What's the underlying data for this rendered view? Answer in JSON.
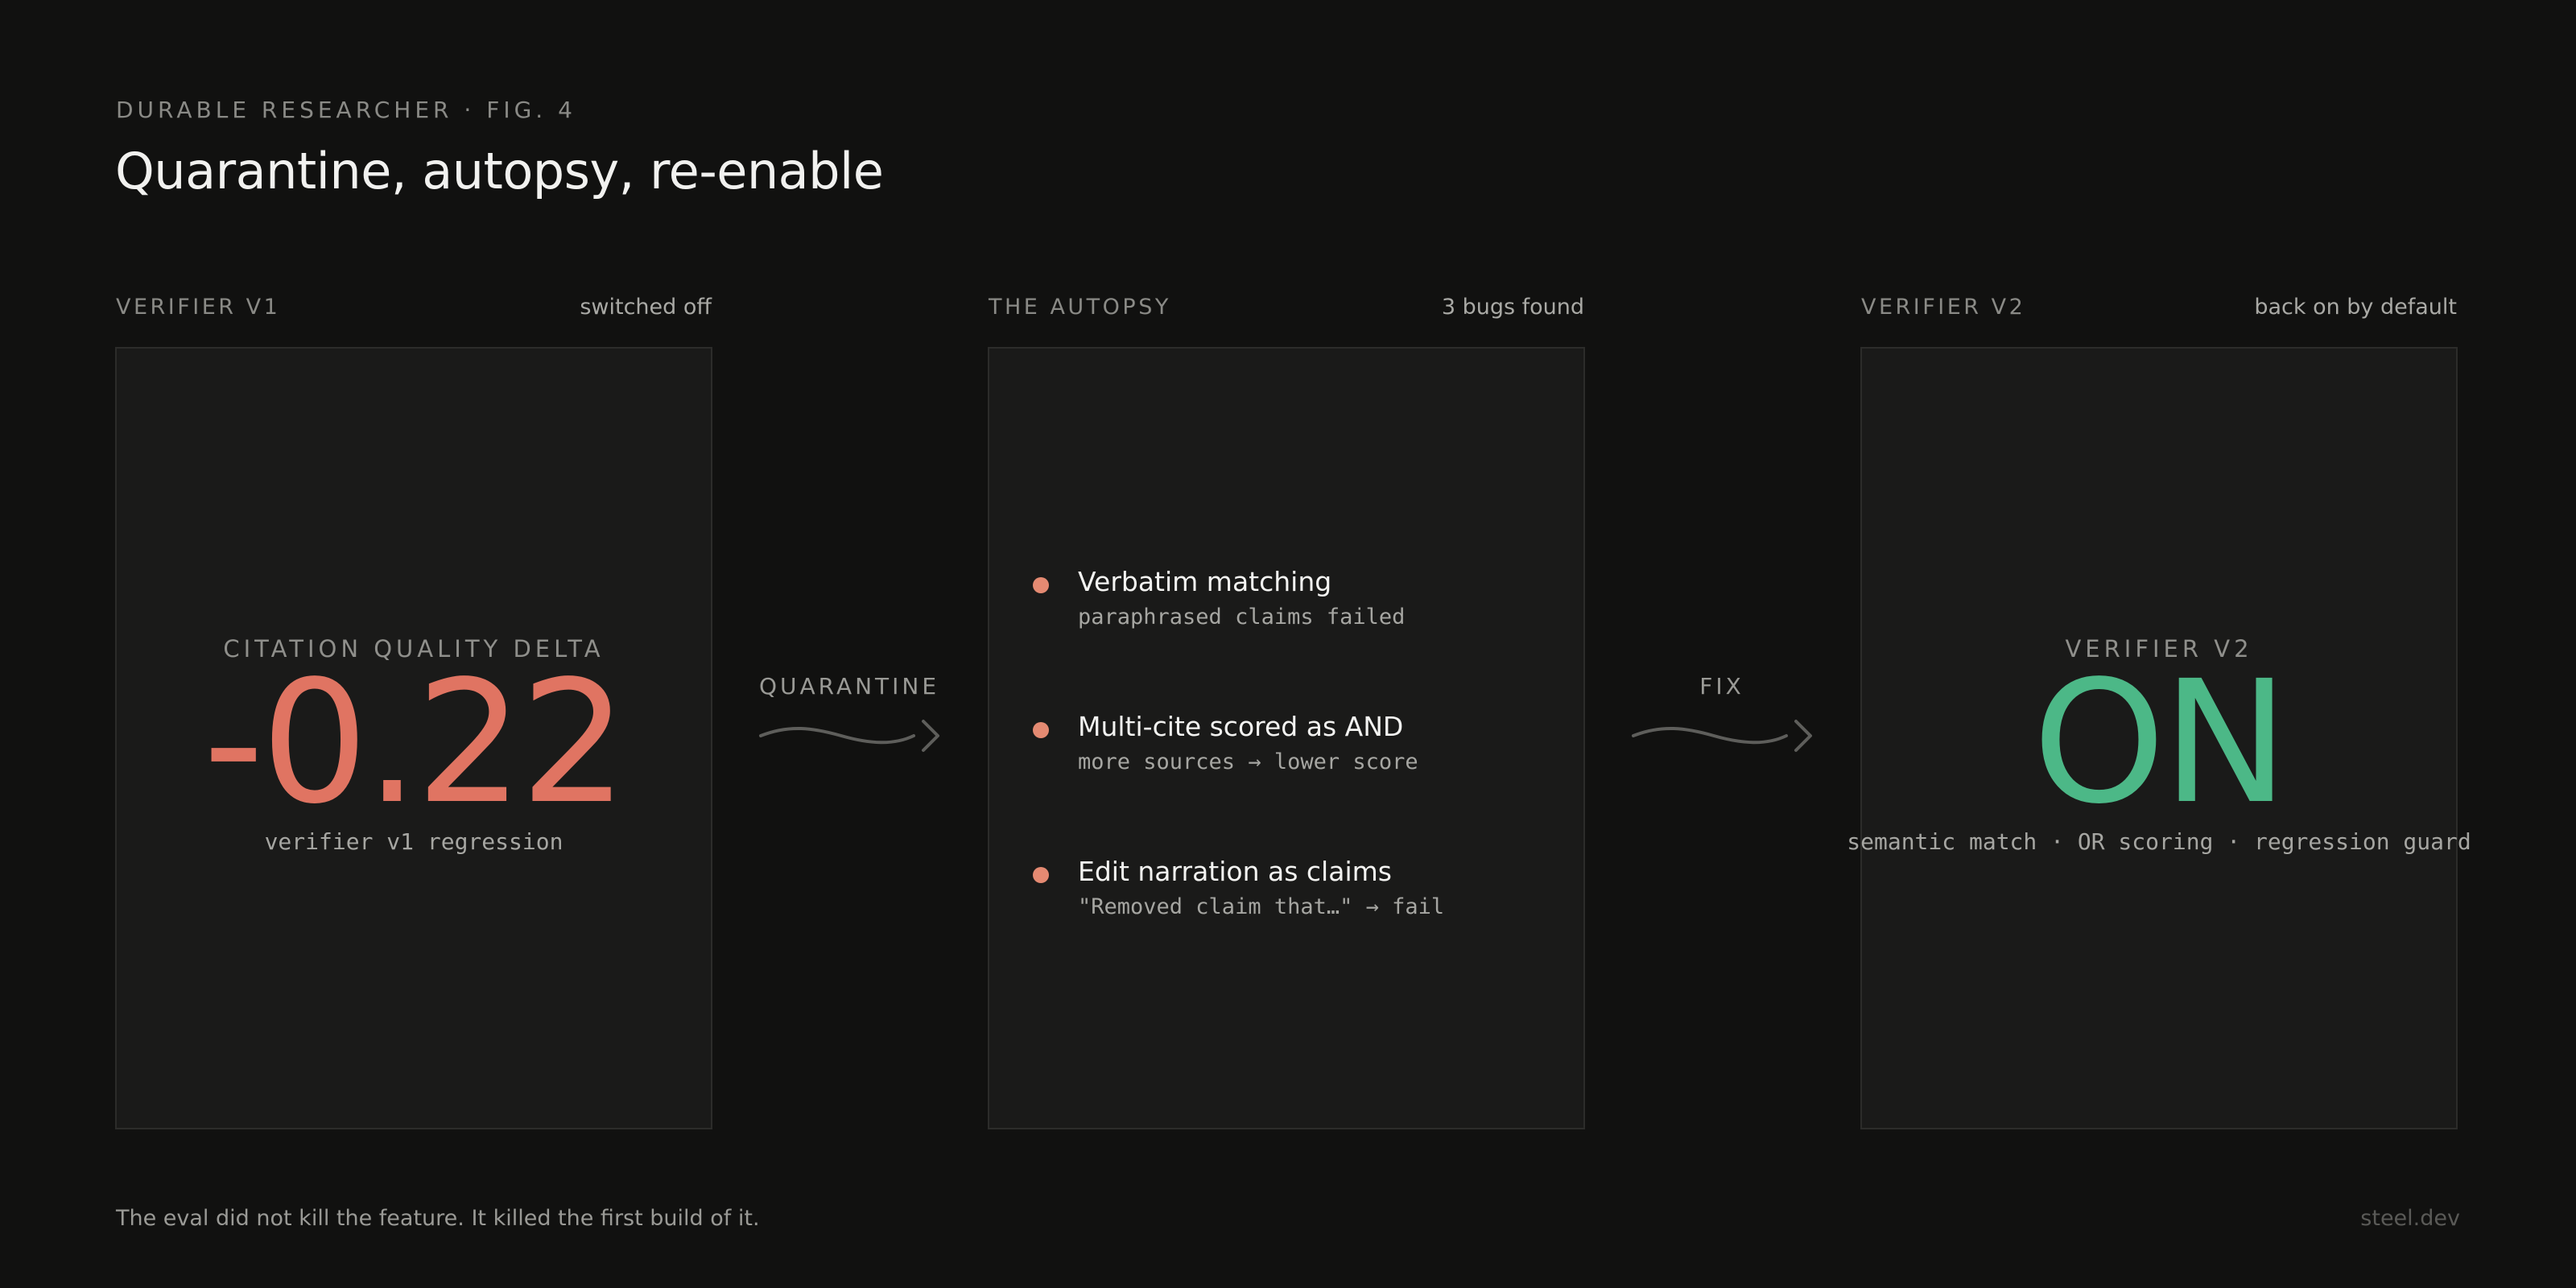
{
  "header": {
    "eyebrow": "DURABLE RESEARCHER · FIG. 4",
    "title": "Quarantine, autopsy, re-enable"
  },
  "panels": [
    {
      "label": "VERIFIER V1",
      "status": "switched off",
      "kicker": "CITATION QUALITY DELTA",
      "value": "-0.22",
      "caption": "verifier v1 regression"
    },
    {
      "label": "THE AUTOPSY",
      "status": "3 bugs found",
      "bugs": [
        {
          "title": "Verbatim matching",
          "desc": "paraphrased claims failed"
        },
        {
          "title": "Multi-cite scored as AND",
          "desc": "more sources → lower score"
        },
        {
          "title": "Edit narration as claims",
          "desc": "\"Removed claim that…\" → fail"
        }
      ]
    },
    {
      "label": "VERIFIER V2",
      "status": "back on by default",
      "kicker": "VERIFIER V2",
      "value": "ON",
      "caption": "semantic match · OR scoring · regression guard"
    }
  ],
  "connectors": [
    {
      "label": "QUARANTINE"
    },
    {
      "label": "FIX"
    }
  ],
  "footer": {
    "note": "The eval did not kill the feature. It killed the first build of it.",
    "brand": "steel.dev"
  },
  "colors": {
    "background": "#111110",
    "panel": "#1a1a19",
    "negative": "#e07462",
    "positive": "#4cb887",
    "bullet": "#e48a72"
  }
}
